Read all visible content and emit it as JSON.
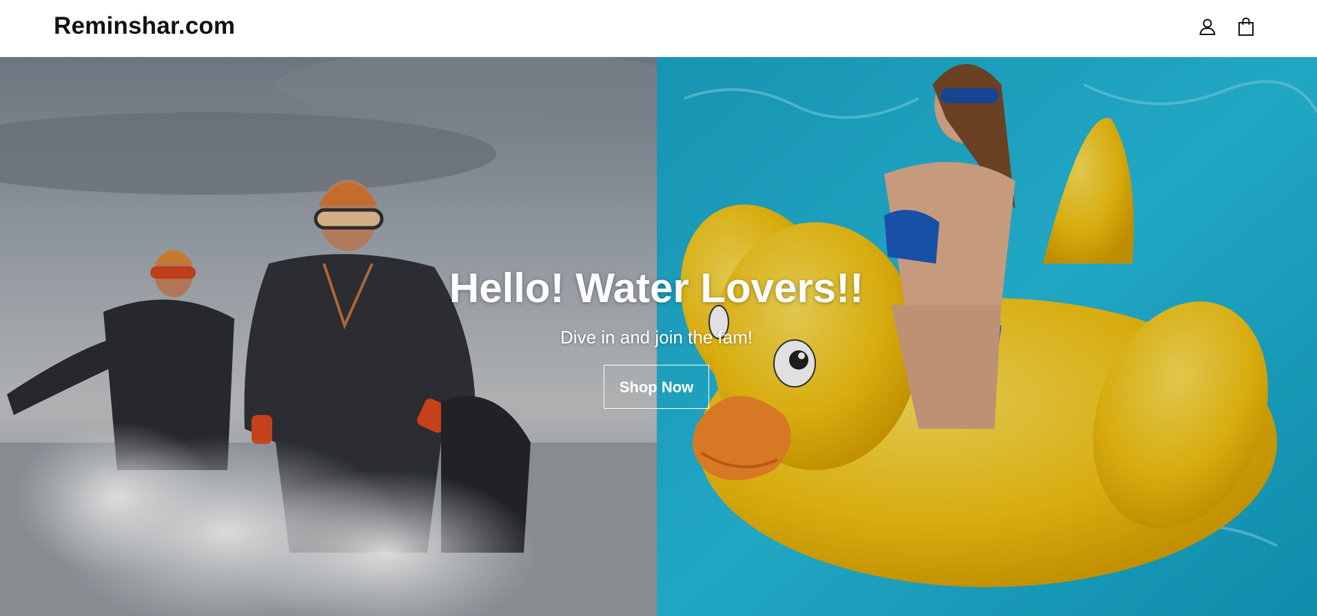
{
  "header": {
    "logo_text": "Reminshar.com",
    "account_icon": "user-icon",
    "cart_icon": "shopping-bag-icon"
  },
  "hero": {
    "title": "Hello! Water Lovers!!",
    "subtitle": "Dive in and join the fam!",
    "button_label": "Shop Now",
    "left_image": "swimmers-running-out-of-water",
    "right_image": "woman-on-yellow-inflatable-duck-in-pool"
  },
  "colors": {
    "header_background": "#ffffff",
    "logo_text": "#111111",
    "hero_text": "#ffffff",
    "duck_yellow": "#f4c20d",
    "pool_blue": "#1fb2d3"
  }
}
